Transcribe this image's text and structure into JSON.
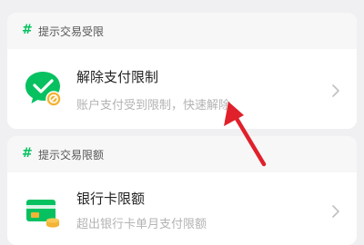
{
  "sections": [
    {
      "hash": "#",
      "title": "提示交易受限",
      "item": {
        "icon": "wechat-pay-restricted-icon",
        "title": "解除支付限制",
        "subtitle": "账户支付受到限制，快速解除"
      }
    },
    {
      "hash": "#",
      "title": "提示交易限额",
      "item": {
        "icon": "bank-card-icon",
        "title": "银行卡限额",
        "subtitle": "超出银行卡单月支付限额"
      }
    }
  ],
  "annotation": {
    "icon": "red-pointer-arrow",
    "color": "#e0202a"
  },
  "colors": {
    "accent": "#07c160",
    "card_gold": "#f3b334"
  }
}
